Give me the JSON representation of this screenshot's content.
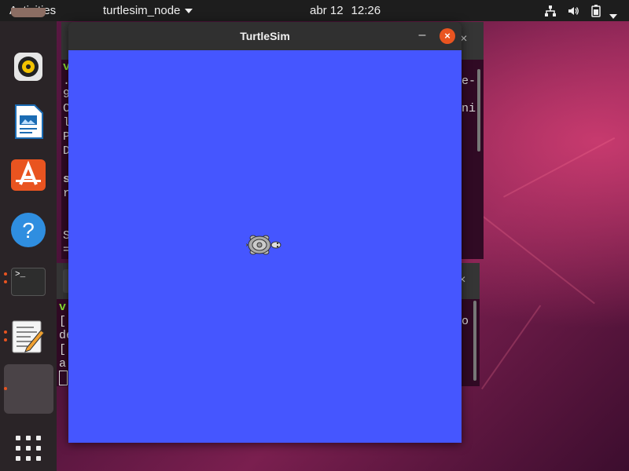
{
  "topbar": {
    "activities": "Activities",
    "app_menu": "turtlesim_node",
    "date": "abr 12",
    "time": "12:26",
    "indicators": [
      "network-icon",
      "volume-icon",
      "battery-icon",
      "power-menu-icon"
    ]
  },
  "dock": {
    "items": [
      {
        "name": "rhythmbox",
        "icon": "speaker-icon"
      },
      {
        "name": "libreoffice-writer",
        "icon": "document-icon"
      },
      {
        "name": "ubuntu-software",
        "icon": "software-store-icon"
      },
      {
        "name": "help",
        "icon": "help-icon"
      },
      {
        "name": "terminal",
        "icon": "terminal-icon",
        "running": true
      },
      {
        "name": "text-editor",
        "icon": "text-editor-icon",
        "running": true
      },
      {
        "name": "turtlesim",
        "icon": "app-icon",
        "running": true,
        "active": true
      },
      {
        "name": "show-applications",
        "icon": "grid-icon"
      }
    ],
    "terminal_prompt": ">_"
  },
  "windows": {
    "turtlesim": {
      "title": "TurtleSim",
      "minimize": "–",
      "close": "×",
      "background_color": "#4556ff"
    },
    "back_terminal_1": {
      "close": "×",
      "left_chars": [
        "v",
        ".",
        "9",
        "C",
        "l",
        "P",
        "D",
        "",
        "s",
        "r",
        "",
        "",
        "S",
        "="
      ],
      "right_chars": [
        "e-",
        "",
        "ni",
        ""
      ]
    },
    "back_terminal_2": {
      "close": "×",
      "left_chars": [
        "v",
        "[",
        "de",
        "[",
        "a"
      ],
      "right_chars": [
        "o"
      ]
    }
  }
}
